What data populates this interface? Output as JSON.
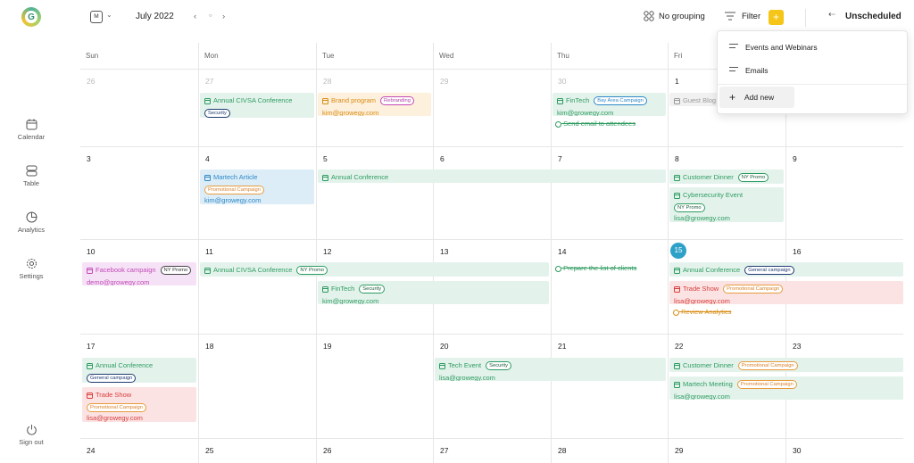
{
  "sidebar": {
    "logo_letter": "G",
    "items": [
      {
        "label": "Calendar",
        "icon": "calendar-icon"
      },
      {
        "label": "Table",
        "icon": "table-icon"
      },
      {
        "label": "Analytics",
        "icon": "pie-chart-icon"
      },
      {
        "label": "Settings",
        "icon": "gear-icon"
      },
      {
        "label": "Sign out",
        "icon": "power-icon"
      }
    ]
  },
  "header": {
    "view_letter": "M",
    "month": "July 2022",
    "no_grouping": "No grouping",
    "filter": "Filter",
    "add_symbol": "+",
    "unscheduled": "Unscheduled"
  },
  "dropdown": {
    "items": [
      "Events and Webinars",
      "Emails"
    ],
    "add_new": "Add new"
  },
  "weekdays": [
    "Sun",
    "Mon",
    "Tue",
    "Wed",
    "Thu",
    "Fri",
    "Sat"
  ],
  "weeks": [
    [
      "26",
      "27",
      "28",
      "29",
      "30",
      "1",
      ""
    ],
    [
      "3",
      "4",
      "5",
      "6",
      "7",
      "8",
      "9"
    ],
    [
      "10",
      "11",
      "12",
      "13",
      "14",
      "15",
      "16"
    ],
    [
      "17",
      "18",
      "19",
      "20",
      "21",
      "22",
      "23"
    ],
    [
      "24",
      "25",
      "26",
      "27",
      "28",
      "29",
      "30"
    ]
  ],
  "events": {
    "e1": {
      "title": "Annual CIVSA Conference",
      "chip": "Security"
    },
    "e2": {
      "title": "Brand program",
      "chip": "Rebranding",
      "sub": "kim@growegy.com"
    },
    "e3": {
      "title": "FinTech",
      "chip": "Bay Area Campaign",
      "sub": "kim@growegy.com"
    },
    "t1": "Send email to attendees",
    "e4": {
      "title": "Guest Blog"
    },
    "e5": {
      "title": "Martech Article",
      "chip": "Promotional Campaign",
      "sub": "kim@growegy.com"
    },
    "e6": {
      "title": "Annual Conference"
    },
    "e7": {
      "title": "Customer Dinner",
      "chip": "NY Promo"
    },
    "e8": {
      "title": "Cybersecurity Event",
      "chip": "NY Promo",
      "sub": "lisa@growegy.com"
    },
    "e9": {
      "title": "Facebook campaign",
      "chip": "NY Promo",
      "sub": "demo@growegy.com"
    },
    "e10": {
      "title": "Annual CIVSA Conference",
      "chip": "NY Promo"
    },
    "e11": {
      "title": "FinTech",
      "chip": "Security",
      "sub": "kim@growegy.com"
    },
    "t2": "Prepare the list of clients",
    "e12": {
      "title": "Annual Conference",
      "chip": "General campaign"
    },
    "e13": {
      "title": "Trade Show",
      "chip": "Promotional Campaign",
      "sub": "lisa@growegy.com"
    },
    "t3": "Review Analytics",
    "e14": {
      "title": "Annual Conference",
      "chip": "General campaign"
    },
    "e15": {
      "title": "Trade Show",
      "chip": "Promotional Campaign",
      "sub": "lisa@growegy.com"
    },
    "e16": {
      "title": "Tech Event",
      "chip": "Security",
      "sub": "lisa@growegy.com"
    },
    "e17": {
      "title": "Customer Dinner",
      "chip": "Promotional Campaign"
    },
    "e18": {
      "title": "Martech Meeting",
      "chip": "Promotional Campaign",
      "sub": "lisa@growegy.com"
    }
  },
  "colors": {
    "accent": "#f5c518",
    "today": "#2ea1c8",
    "green": "#2e9b60",
    "red": "#d93c3c",
    "blue": "#2f88c7",
    "orange": "#d98d16",
    "purple": "#c24ab7"
  }
}
